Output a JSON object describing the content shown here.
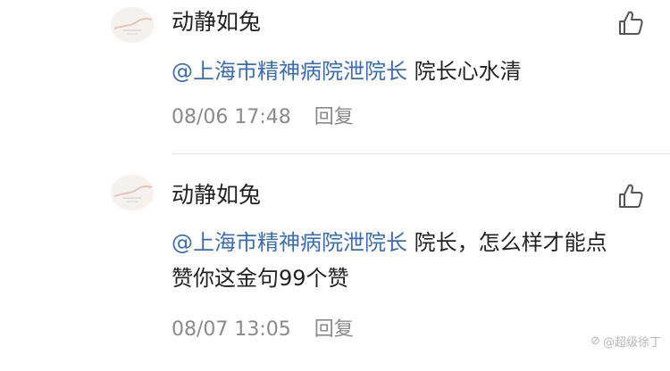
{
  "comments": [
    {
      "username": "动静如兔",
      "mention": "@上海市精神病院泄院长",
      "text": " 院长心水清",
      "date": "08/06 17:48",
      "reply_label": "回复"
    },
    {
      "username": "动静如兔",
      "mention": "@上海市精神病院泄院长",
      "text": " 院长，怎么样才能点赞你这金句99个赞",
      "date": "08/07 13:05",
      "reply_label": "回复"
    }
  ],
  "icons": {
    "like": "thumbs-up-icon",
    "avatar": "avatar"
  },
  "colors": {
    "mention": "#3b6cb3",
    "meta": "#8a8a8a",
    "text": "#222222",
    "divider": "#e8e8e8"
  },
  "watermark": {
    "text": "@超级徐丁"
  }
}
